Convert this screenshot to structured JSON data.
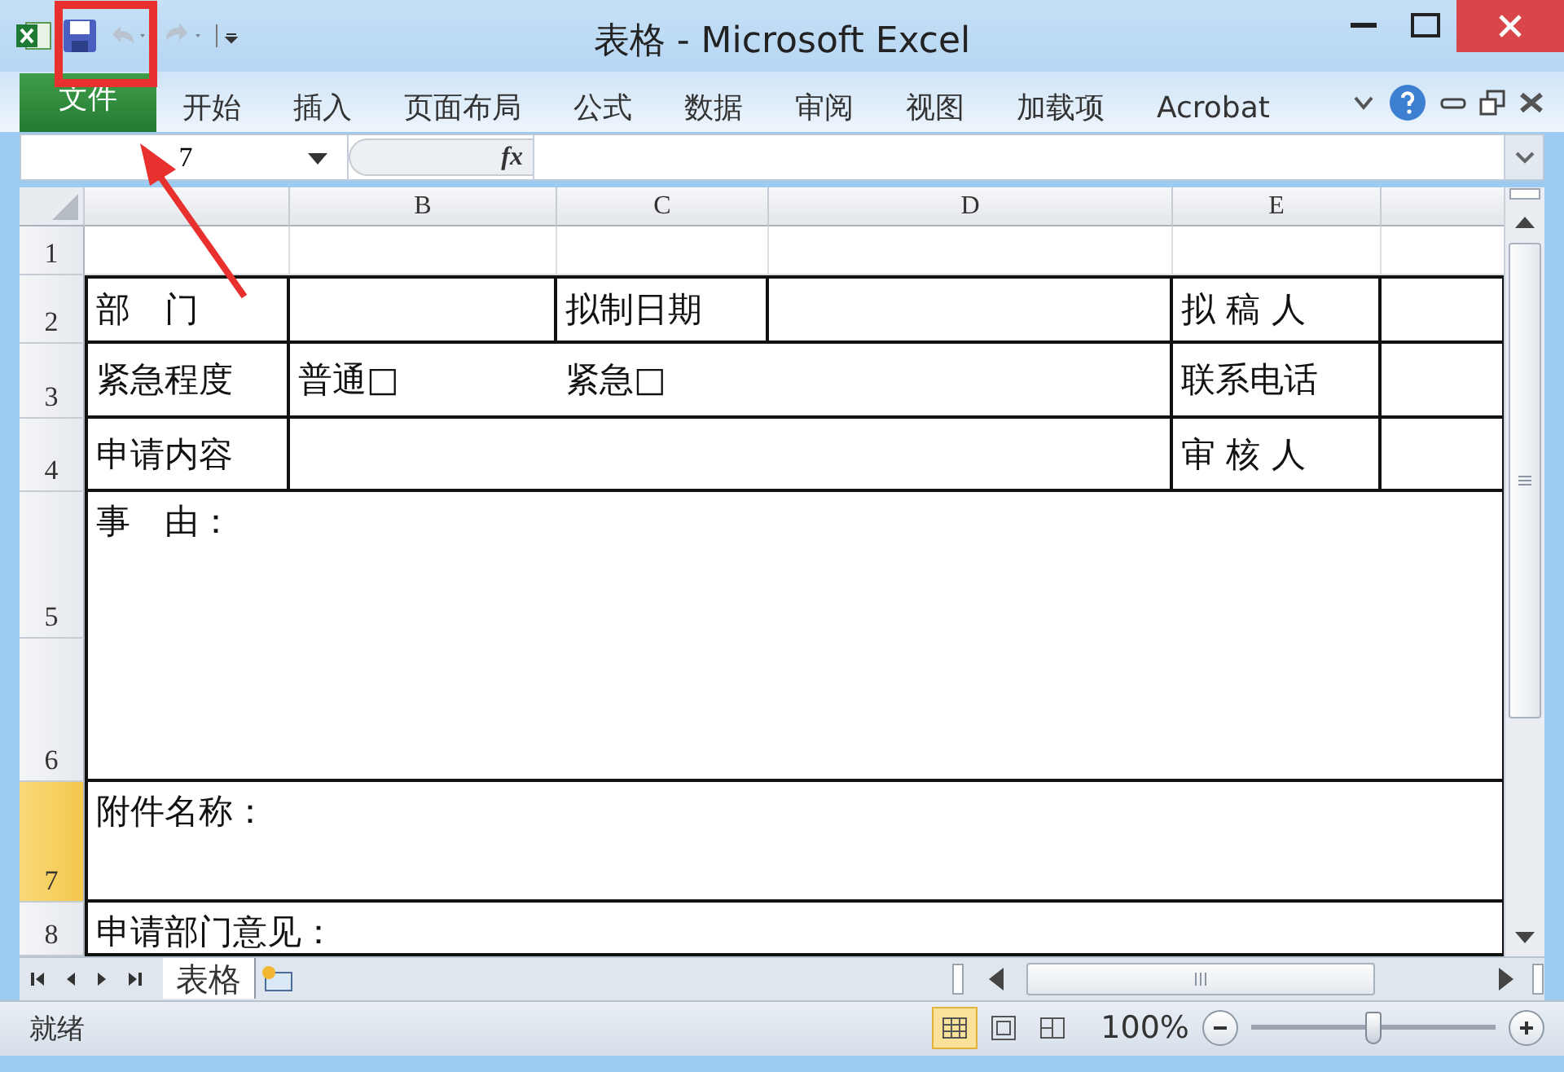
{
  "window": {
    "title": "表格 - Microsoft Excel"
  },
  "quick_access": [
    {
      "kind": "save",
      "disabled": false
    },
    {
      "kind": "undo",
      "disabled": true
    },
    {
      "kind": "redo",
      "disabled": true
    }
  ],
  "ribbon_tabs": [
    {
      "label": "文件",
      "kind": "file"
    },
    {
      "label": "开始",
      "kind": "tab"
    },
    {
      "label": "插入",
      "kind": "tab"
    },
    {
      "label": "页面布局",
      "kind": "tab"
    },
    {
      "label": "公式",
      "kind": "tab"
    },
    {
      "label": "数据",
      "kind": "tab"
    },
    {
      "label": "审阅",
      "kind": "tab"
    },
    {
      "label": "视图",
      "kind": "tab"
    },
    {
      "label": "加载项",
      "kind": "tab"
    },
    {
      "label": "Acrobat",
      "kind": "tab"
    }
  ],
  "formula_bar": {
    "name_box": "7",
    "function_label": "fx"
  },
  "columns": [
    {
      "label": "B"
    },
    {
      "label": "C"
    },
    {
      "label": "D"
    },
    {
      "label": "E"
    }
  ],
  "row_headers": [
    {
      "label": "1",
      "selected": false
    },
    {
      "label": "2",
      "selected": false
    },
    {
      "label": "3",
      "selected": false
    },
    {
      "label": "4",
      "selected": false
    },
    {
      "label": "5",
      "selected": false
    },
    {
      "label": "6",
      "selected": false
    },
    {
      "label": "7",
      "selected": true
    },
    {
      "label": "8",
      "selected": false
    }
  ],
  "form": [
    {
      "kind": "blank"
    },
    {
      "kind": "four_field",
      "cells": [
        "部　门",
        "拟制日期",
        "拟 稿 人"
      ]
    },
    {
      "kind": "choice",
      "cells": [
        "紧急程度",
        "普通□",
        "紧急□",
        "联系电话"
      ]
    },
    {
      "kind": "two_field",
      "cells": [
        "申请内容",
        "审 核 人"
      ]
    },
    {
      "kind": "tall",
      "cells": [
        "事　由："
      ]
    },
    {
      "kind": "wide",
      "cells": [
        "附件名称："
      ]
    },
    {
      "kind": "wide",
      "cells": [
        "申请部门意见："
      ]
    }
  ],
  "sheet_tabs": [
    {
      "label": "表格",
      "selected": true
    }
  ],
  "status_bar": {
    "text": "就绪",
    "views": [
      {
        "kind": "normal",
        "selected": true
      },
      {
        "kind": "page_layout",
        "selected": false
      },
      {
        "kind": "page_break",
        "selected": false
      }
    ],
    "zoom": "100%",
    "zoom_slider": {
      "level": 0.5
    }
  }
}
